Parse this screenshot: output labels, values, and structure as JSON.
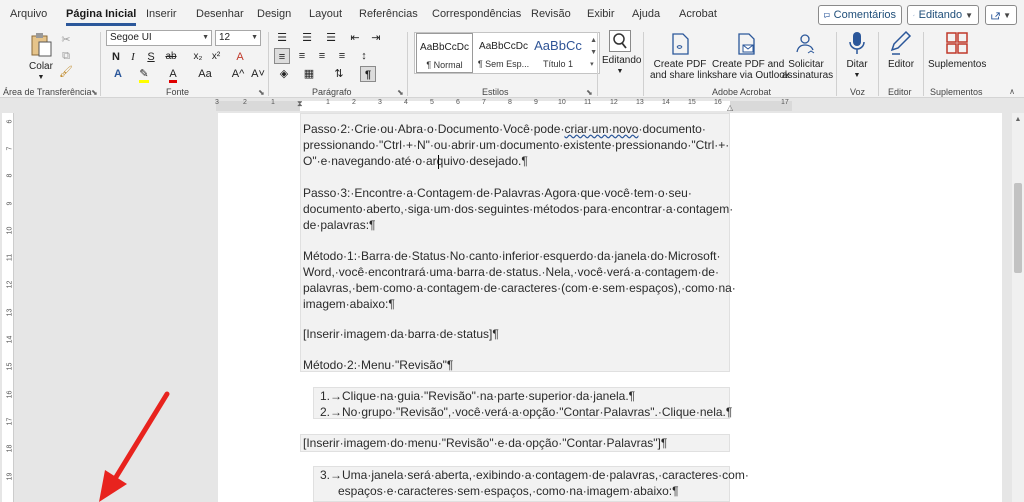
{
  "menu": {
    "tabs": [
      "Arquivo",
      "Página Inicial",
      "Inserir",
      "Desenhar",
      "Design",
      "Layout",
      "Referências",
      "Correspondências",
      "Revisão",
      "Exibir",
      "Ajuda",
      "Acrobat"
    ],
    "active_tab": "Página Inicial"
  },
  "top_buttons": {
    "comments": "Comentários",
    "editing": "Editando"
  },
  "ribbon": {
    "clipboard": {
      "paste": "Colar",
      "group": "Área de Transferência"
    },
    "font": {
      "name": "Segoe UI",
      "size": "12",
      "group": "Fonte",
      "bold": "N",
      "italic": "I",
      "underline": "S",
      "strike": "ab",
      "sub": "x₂",
      "sup": "x²",
      "clear": "A",
      "case": "Aa",
      "grow": "A^",
      "shrink": "A˅"
    },
    "paragraph": {
      "group": "Parágrafo",
      "pilcrow": "¶"
    },
    "styles": {
      "group": "Estilos",
      "items": [
        {
          "sample": "AaBbCcDc",
          "name": "¶ Normal"
        },
        {
          "sample": "AaBbCcDc",
          "name": "¶ Sem Esp..."
        },
        {
          "sample": "AaBbCc",
          "name": "Título 1"
        }
      ]
    },
    "editing": {
      "label": "Editando"
    },
    "acrobat": {
      "group": "Adobe Acrobat",
      "create_pdf": [
        "Create PDF",
        "and share link"
      ],
      "create_pdf_outlook": [
        "Create PDF and",
        "share via Outlook"
      ],
      "request_sign": [
        "Solicitar",
        "assinaturas"
      ]
    },
    "voice": {
      "label": "Ditar",
      "group": "Voz"
    },
    "editor": {
      "label": "Editor",
      "group": "Editor"
    },
    "addins": {
      "label": "Suplementos",
      "group": "Suplementos"
    }
  },
  "ruler": {
    "ticks": [
      "3",
      "2",
      "1",
      "1",
      "2",
      "3",
      "4",
      "5",
      "6",
      "7",
      "8",
      "9",
      "10",
      "11",
      "12",
      "13",
      "14",
      "15",
      "16",
      "17"
    ]
  },
  "vruler": {
    "ticks": [
      "6",
      "7",
      "8",
      "9",
      "10",
      "11",
      "12",
      "13",
      "14",
      "15",
      "16",
      "17",
      "18",
      "19"
    ]
  },
  "document": {
    "p1": [
      "Passo·2:·Crie·ou·Abra·o·Documento·Você·pode·",
      "criar·um·novo",
      "·documento·",
      "pressionando·\"Ctrl·+·N\"·ou·abrir·um·documento·existente·pressionando·\"Ctrl·+·",
      "O\"·e·navegando·até·o·arquivo·desejado.¶"
    ],
    "p2": [
      "Passo·3:·Encontre·a·Contagem·de·Palavras·Agora·que·você·tem·o·seu·",
      "documento·aberto,·siga·um·dos·seguintes·métodos·para·encontrar·a·contagem·",
      "de·palavras:¶"
    ],
    "p3": [
      "Método·1:·Barra·de·Status·No·canto·inferior·esquerdo·da·janela·do·Microsoft·",
      "Word,·você·encontrará·uma·barra·de·status.·Nela,·você·verá·a·contagem·de·",
      "palavras,·bem·como·a·contagem·de·caracteres·(com·e·sem·espaços),·como·na·",
      "imagem·abaixo:¶"
    ],
    "p4": "[Inserir·imagem·da·barra·de·status]¶",
    "p5": "Método·2:·Menu·\"Revisão\"¶",
    "list1": [
      "1.→Clique·na·guia·\"Revisão\"·na·parte·superior·da·janela.¶",
      "2.→No·grupo·\"Revisão\",·você·verá·a·opção·\"Contar·Palavras\".·Clique·nela.¶"
    ],
    "p6": "[Inserir·imagem·do·menu·\"Revisão\"·e·da·opção·\"Contar·Palavras\"]¶",
    "list2": [
      "3.→Uma·janela·será·aberta,·exibindo·a·contagem·de·palavras,·caracteres·com·",
      "espaços·e·caracteres·sem·espaços,·como·na·imagem·abaixo:¶"
    ]
  },
  "colors": {
    "accent": "#2b579a",
    "annotation_arrow": "#e8231e"
  }
}
